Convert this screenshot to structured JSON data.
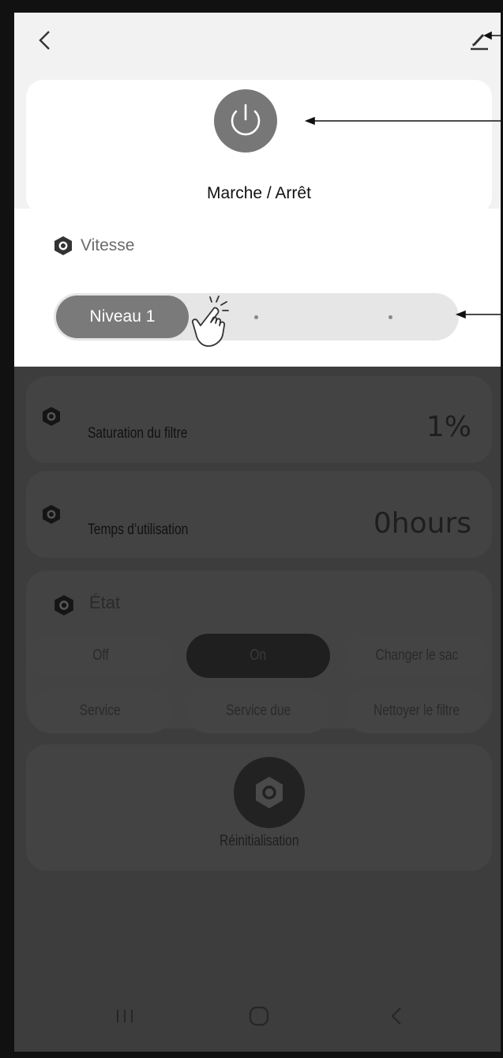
{
  "header": {
    "back_icon": "chevron-left-icon",
    "edit_icon": "pencil-icon"
  },
  "power": {
    "label": "Marche / Arrêt",
    "icon": "power-icon",
    "button_color": "#777777"
  },
  "speed": {
    "title": "Vitesse",
    "icon": "hexagon-gear-icon",
    "selected_label": "Niveau 1",
    "level": 1,
    "levels_total": 3
  },
  "filter_saturation": {
    "label": "Saturation du filtre",
    "value": "1%"
  },
  "usage_time": {
    "label": "Temps d’utilisation",
    "value": "0hours"
  },
  "state": {
    "title": "État",
    "options": [
      "Off",
      "On",
      "Changer le sac",
      "Service",
      "Service due",
      "Nettoyer le filtre"
    ],
    "selected": "On"
  },
  "reset": {
    "label": "Réinitialisation"
  },
  "navbar": {
    "items": [
      "recent-apps-icon",
      "home-icon",
      "back-icon"
    ]
  },
  "colors": {
    "overlay": "#3d3d3d",
    "card": "#ffffff",
    "accent_gray": "#7a7a7a"
  }
}
